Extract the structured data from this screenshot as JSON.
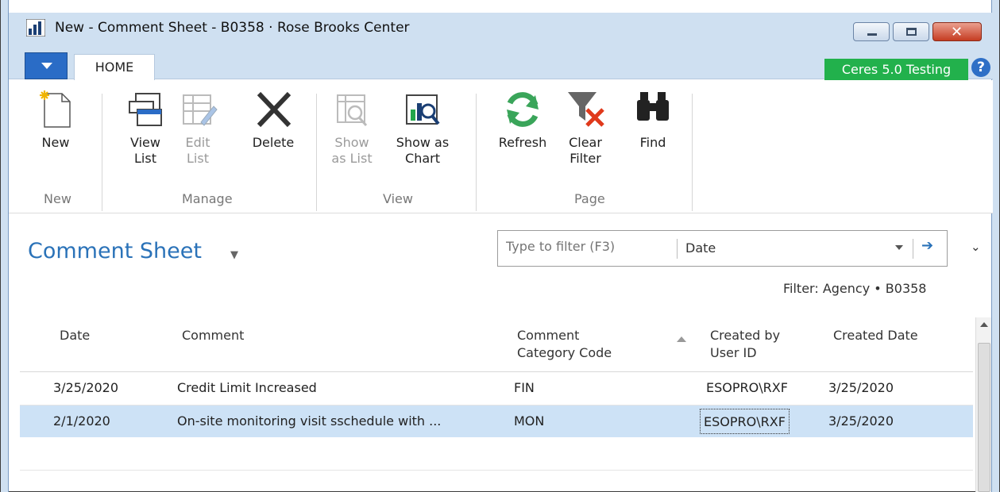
{
  "window": {
    "title": "New - Comment Sheet - B0358 · Rose Brooks Center"
  },
  "tabs": {
    "home": "HOME",
    "env_badge": "Ceres 5.0 Testing",
    "help": "?"
  },
  "ribbon": {
    "new": {
      "l1": "New",
      "l2": ""
    },
    "view_list": {
      "l1": "View",
      "l2": "List"
    },
    "edit_list": {
      "l1": "Edit",
      "l2": "List"
    },
    "delete": {
      "l1": "Delete",
      "l2": ""
    },
    "show_as_list": {
      "l1": "Show",
      "l2": "as List"
    },
    "show_as_chart": {
      "l1": "Show as",
      "l2": "Chart"
    },
    "refresh": {
      "l1": "Refresh",
      "l2": ""
    },
    "clear_filter": {
      "l1": "Clear",
      "l2": "Filter"
    },
    "find": {
      "l1": "Find",
      "l2": ""
    },
    "groups": {
      "new": "New",
      "manage": "Manage",
      "view": "View",
      "page": "Page"
    }
  },
  "page": {
    "title": "Comment Sheet",
    "filter_placeholder": "Type to filter (F3)",
    "filter_field": "Date",
    "filter_status": "Filter: Agency • B0358"
  },
  "table": {
    "headers": {
      "date": "Date",
      "comment": "Comment",
      "category_l1": "Comment",
      "category_l2": "Category Code",
      "created_by_l1": "Created by",
      "created_by_l2": "User ID",
      "created_date": "Created Date"
    },
    "rows": [
      {
        "date": "3/25/2020",
        "comment": "Credit Limit Increased",
        "category": "FIN",
        "created_by": "ESOPRO\\RXF",
        "created_date": "3/25/2020"
      },
      {
        "date": "2/1/2020",
        "comment": "On-site monitoring visit sschedule with ...",
        "category": "MON",
        "created_by": "ESOPRO\\RXF",
        "created_date": "3/25/2020"
      }
    ]
  },
  "colors": {
    "accent_blue": "#2a72b8",
    "badge_green": "#22b14c",
    "selected_row": "#cde2f6",
    "chrome": "#cfe0f1"
  }
}
